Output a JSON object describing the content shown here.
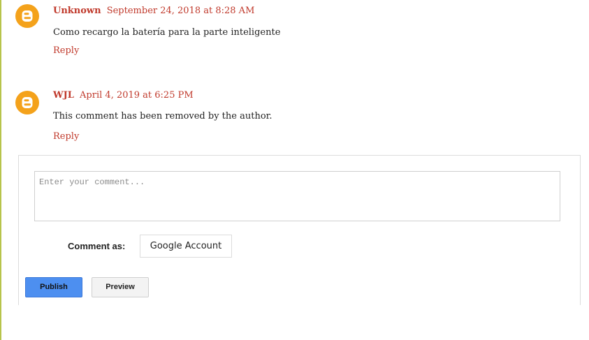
{
  "comments": [
    {
      "author": "Unknown",
      "date": "September 24, 2018 at 8:28 AM",
      "text": "Como recargo la batería para la parte inteligente",
      "reply_label": "Reply"
    },
    {
      "author": "WJL",
      "date": "April 4, 2019 at 6:25 PM",
      "text": "This comment has been removed by the author.",
      "reply_label": "Reply"
    }
  ],
  "form": {
    "placeholder": "Enter your comment...",
    "comment_as_label": "Comment as:",
    "account_value": "Google Account",
    "publish_label": "Publish",
    "preview_label": "Preview"
  },
  "colors": {
    "link": "#c0392b",
    "avatar": "#f4a21b",
    "publish": "#4d8ff0",
    "rule": "#b7c44b"
  },
  "icons": {
    "avatar": "blogger-icon"
  }
}
